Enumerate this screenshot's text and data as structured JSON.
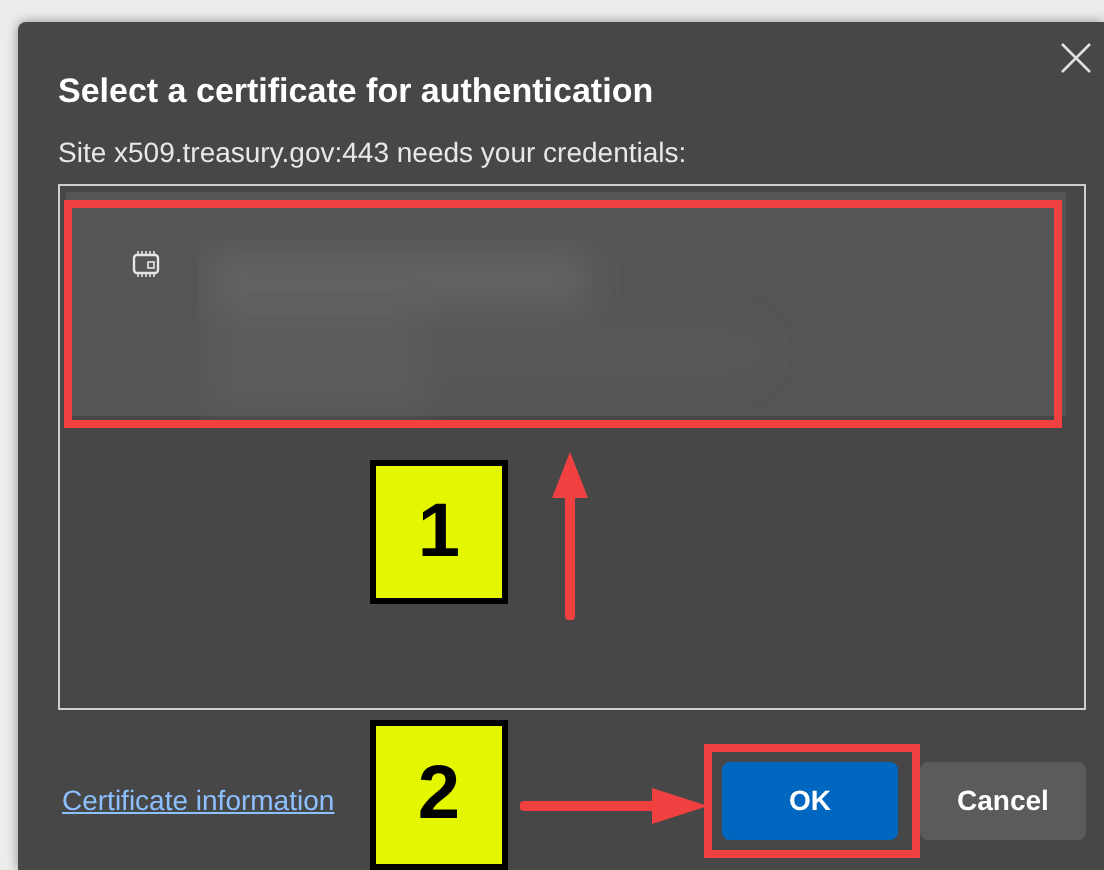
{
  "dialog": {
    "title": "Select a certificate for authentication",
    "subtitle": "Site x509.treasury.gov:443 needs your credentials:",
    "certificates": [
      {
        "selected": true
      }
    ],
    "link": "Certificate information",
    "buttons": [
      {
        "label": "OK",
        "kind": "primary"
      },
      {
        "label": "Cancel",
        "kind": "secondary"
      }
    ]
  },
  "annotations": [
    {
      "label": "1"
    },
    {
      "label": "2"
    }
  ]
}
